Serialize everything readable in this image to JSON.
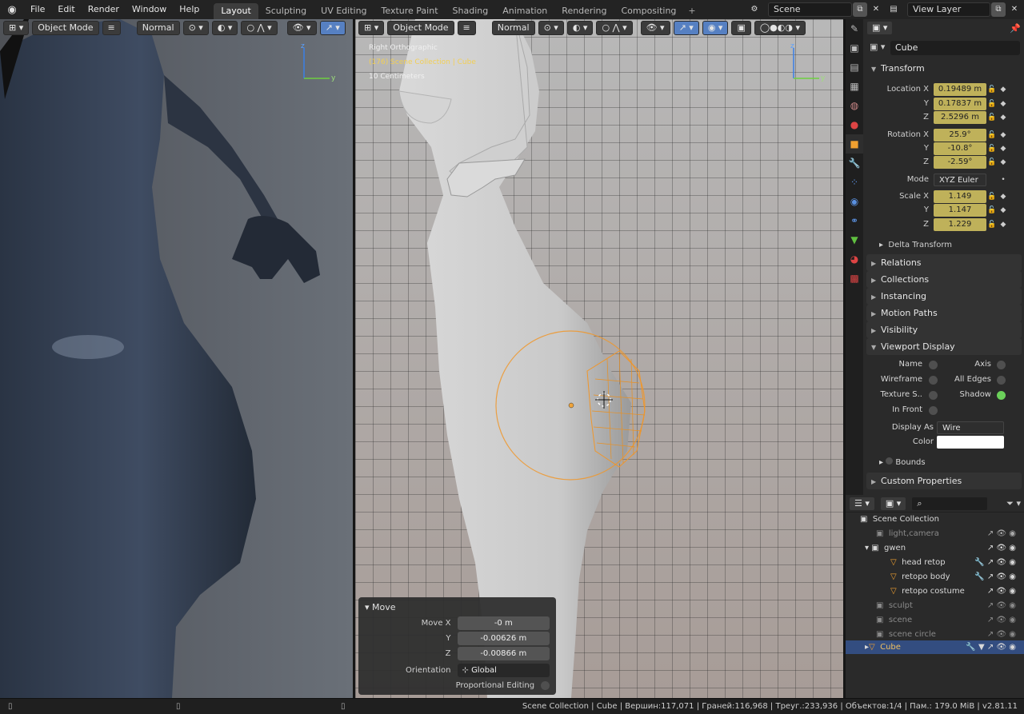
{
  "topbar": {
    "menus": [
      "File",
      "Edit",
      "Render",
      "Window",
      "Help"
    ],
    "workspaces": [
      "Layout",
      "Sculpting",
      "UV Editing",
      "Texture Paint",
      "Shading",
      "Animation",
      "Rendering",
      "Compositing"
    ],
    "active_workspace": "Layout",
    "scene": "Scene",
    "view_layer": "View Layer"
  },
  "left_viewport": {
    "mode": "Object Mode",
    "orientation": "Normal"
  },
  "right_viewport": {
    "mode": "Object Mode",
    "orientation": "Normal",
    "view_name": "Right Orthographic",
    "collection_path": "(176) Scene Collection | Cube",
    "scale_text": "10 Centimeters"
  },
  "redo_panel": {
    "title": "Move",
    "rows": [
      {
        "label": "Move X",
        "value": "-0 m"
      },
      {
        "label": "Y",
        "value": "-0.00626 m"
      },
      {
        "label": "Z",
        "value": "-0.00866 m"
      }
    ],
    "orientation_label": "Orientation",
    "orientation_value": "Global",
    "proportional_label": "Proportional Editing"
  },
  "properties": {
    "object_name": "Cube",
    "transform_title": "Transform",
    "location": [
      {
        "label": "Location X",
        "value": "0.19489 m"
      },
      {
        "label": "Y",
        "value": "0.17837 m"
      },
      {
        "label": "Z",
        "value": "2.5296 m"
      }
    ],
    "rotation": [
      {
        "label": "Rotation X",
        "value": "25.9°"
      },
      {
        "label": "Y",
        "value": "-10.8°"
      },
      {
        "label": "Z",
        "value": "-2.59°"
      }
    ],
    "mode_label": "Mode",
    "mode_value": "XYZ Euler",
    "scale": [
      {
        "label": "Scale X",
        "value": "1.149"
      },
      {
        "label": "Y",
        "value": "1.147"
      },
      {
        "label": "Z",
        "value": "1.229"
      }
    ],
    "delta_transform": "Delta Transform",
    "panels": [
      "Relations",
      "Collections",
      "Instancing",
      "Motion Paths",
      "Visibility"
    ],
    "viewport_display": "Viewport Display",
    "vd_left": [
      "Name",
      "Wireframe",
      "Texture S..",
      "In Front"
    ],
    "vd_right": [
      "Axis",
      "All Edges",
      "Shadow"
    ],
    "display_as_label": "Display As",
    "display_as_value": "Wire",
    "color_label": "Color",
    "bounds": "Bounds",
    "custom_properties": "Custom Properties"
  },
  "outliner": {
    "root": "Scene Collection",
    "rows": [
      {
        "name": "light,camera",
        "dim": true,
        "indent": 1
      },
      {
        "name": "gwen",
        "dim": false,
        "indent": 1
      },
      {
        "name": "head retop",
        "dim": false,
        "indent": 2
      },
      {
        "name": "retopo body",
        "dim": false,
        "indent": 2
      },
      {
        "name": "retopo costume",
        "dim": false,
        "indent": 2
      },
      {
        "name": "sculpt",
        "dim": true,
        "indent": 1
      },
      {
        "name": "scene",
        "dim": true,
        "indent": 1
      },
      {
        "name": "scene circle",
        "dim": true,
        "indent": 1
      },
      {
        "name": "Cube",
        "dim": false,
        "indent": 1,
        "selected": true
      }
    ]
  },
  "statusbar": {
    "text": "Scene Collection | Cube | Вершин:117,071 | Граней:116,968 | Треуг.:233,936 | Объектов:1/4 | Пам.: 179.0 MiB | v2.81.11"
  },
  "colors": {
    "accent_blue": "#5680c2",
    "anim_yellow": "#bfb15a",
    "selection_orange": "#f0962a"
  }
}
